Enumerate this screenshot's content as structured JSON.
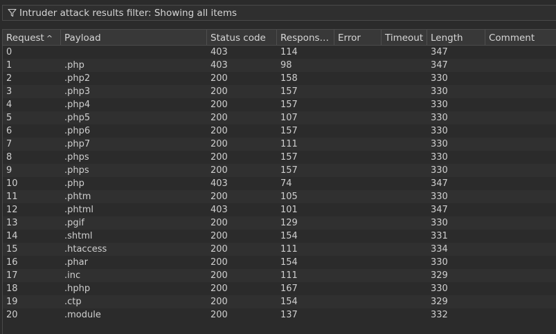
{
  "filter": {
    "label": "Intruder attack results filter: Showing all items"
  },
  "columns": {
    "request": "Request",
    "payload": "Payload",
    "status": "Status code",
    "response": "Respons…",
    "error": "Error",
    "timeout": "Timeout",
    "length": "Length",
    "comment": "Comment"
  },
  "sort": {
    "column": "request",
    "direction": "ascending",
    "arrow": "^"
  },
  "rows": [
    {
      "request": "0",
      "payload": "",
      "status": "403",
      "response": "114",
      "error": "",
      "timeout": "",
      "length": "347",
      "comment": ""
    },
    {
      "request": "1",
      "payload": ".php",
      "status": "403",
      "response": "98",
      "error": "",
      "timeout": "",
      "length": "347",
      "comment": ""
    },
    {
      "request": "2",
      "payload": ".php2",
      "status": "200",
      "response": "158",
      "error": "",
      "timeout": "",
      "length": "330",
      "comment": ""
    },
    {
      "request": "3",
      "payload": ".php3",
      "status": "200",
      "response": "157",
      "error": "",
      "timeout": "",
      "length": "330",
      "comment": ""
    },
    {
      "request": "4",
      "payload": ".php4",
      "status": "200",
      "response": "157",
      "error": "",
      "timeout": "",
      "length": "330",
      "comment": ""
    },
    {
      "request": "5",
      "payload": ".php5",
      "status": "200",
      "response": "107",
      "error": "",
      "timeout": "",
      "length": "330",
      "comment": ""
    },
    {
      "request": "6",
      "payload": ".php6",
      "status": "200",
      "response": "157",
      "error": "",
      "timeout": "",
      "length": "330",
      "comment": ""
    },
    {
      "request": "7",
      "payload": ".php7",
      "status": "200",
      "response": "111",
      "error": "",
      "timeout": "",
      "length": "330",
      "comment": ""
    },
    {
      "request": "8",
      "payload": ".phps",
      "status": "200",
      "response": "157",
      "error": "",
      "timeout": "",
      "length": "330",
      "comment": ""
    },
    {
      "request": "9",
      "payload": ".phps",
      "status": "200",
      "response": "157",
      "error": "",
      "timeout": "",
      "length": "330",
      "comment": ""
    },
    {
      "request": "10",
      "payload": ".php",
      "status": "403",
      "response": "74",
      "error": "",
      "timeout": "",
      "length": "347",
      "comment": ""
    },
    {
      "request": "11",
      "payload": ".phtm",
      "status": "200",
      "response": "105",
      "error": "",
      "timeout": "",
      "length": "330",
      "comment": ""
    },
    {
      "request": "12",
      "payload": ".phtml",
      "status": "403",
      "response": "101",
      "error": "",
      "timeout": "",
      "length": "347",
      "comment": ""
    },
    {
      "request": "13",
      "payload": ".pgif",
      "status": "200",
      "response": "129",
      "error": "",
      "timeout": "",
      "length": "330",
      "comment": ""
    },
    {
      "request": "14",
      "payload": ".shtml",
      "status": "200",
      "response": "154",
      "error": "",
      "timeout": "",
      "length": "331",
      "comment": ""
    },
    {
      "request": "15",
      "payload": ".htaccess",
      "status": "200",
      "response": "111",
      "error": "",
      "timeout": "",
      "length": "334",
      "comment": ""
    },
    {
      "request": "16",
      "payload": ".phar",
      "status": "200",
      "response": "154",
      "error": "",
      "timeout": "",
      "length": "330",
      "comment": ""
    },
    {
      "request": "17",
      "payload": ".inc",
      "status": "200",
      "response": "111",
      "error": "",
      "timeout": "",
      "length": "329",
      "comment": ""
    },
    {
      "request": "18",
      "payload": ".hphp",
      "status": "200",
      "response": "167",
      "error": "",
      "timeout": "",
      "length": "330",
      "comment": ""
    },
    {
      "request": "19",
      "payload": ".ctp",
      "status": "200",
      "response": "154",
      "error": "",
      "timeout": "",
      "length": "329",
      "comment": ""
    },
    {
      "request": "20",
      "payload": ".module",
      "status": "200",
      "response": "137",
      "error": "",
      "timeout": "",
      "length": "332",
      "comment": ""
    }
  ],
  "icons": {
    "filter": "funnel-icon",
    "sort": "sort-ascending-icon"
  },
  "colors": {
    "background": "#2b2b2b",
    "header": "#383838",
    "text": "#cfcfcf",
    "stripe": "#303030"
  }
}
